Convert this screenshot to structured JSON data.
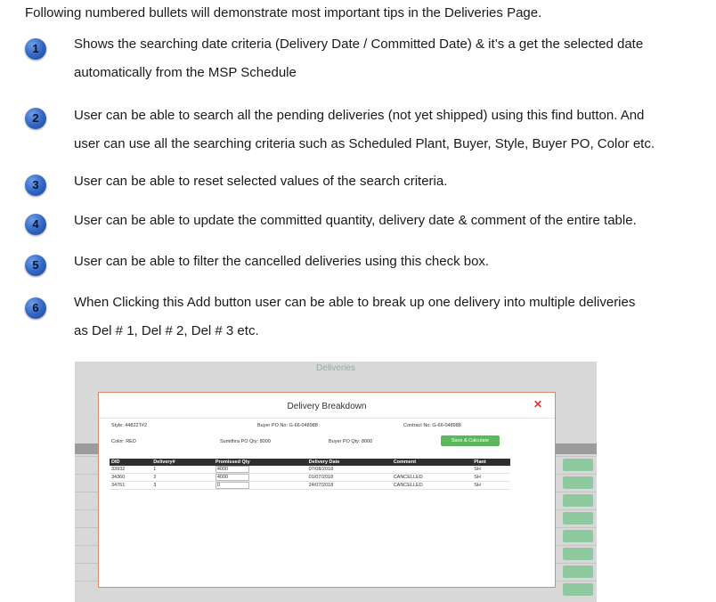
{
  "intro": "Following numbered bullets will demonstrate most important tips in the Deliveries Page.",
  "bullets": [
    {
      "number": "1",
      "line1": "Shows the searching date criteria (Delivery Date / Committed Date) & it’s a get the selected date",
      "line2": "automatically from the MSP Schedule"
    },
    {
      "number": "2",
      "line1": "User can be able to search all the pending deliveries (not yet shipped) using this find button. And",
      "line2": "user can use all the searching criteria such as Scheduled Plant, Buyer, Style, Buyer PO, Color etc."
    },
    {
      "number": "3",
      "line1": "User can be able to reset selected values of the search criteria."
    },
    {
      "number": "4",
      "line1": "User can be able to update the committed quantity, delivery date & comment of the entire table."
    },
    {
      "number": "5",
      "line1": "User can be able to filter the cancelled deliveries using this check box."
    },
    {
      "number": "6",
      "line1": "When Clicking this Add button user can be able to break up one delivery into multiple deliveries",
      "line2": "as Del # 1, Del # 2, Del # 3 etc."
    }
  ],
  "screenshot": {
    "background_title": "Deliveries",
    "modal": {
      "title": "Delivery Breakdown",
      "close_glyph": "✕",
      "style": "Style: 44822T#2",
      "buyer_po_no": "Buyer PO No: G-66-048988",
      "contract_no": "Contract No: G-66-048988",
      "color": "Color: RED",
      "sumithra_po_qty": "Sumithra PO Qty: 8000",
      "buyer_po_qty": "Buyer PO Qty: 8000",
      "save_button": "Save & Calculate",
      "columns": [
        "DID",
        "Delivery#",
        "Promissed Qty",
        "Delivery Date",
        "Comment",
        "Plant"
      ],
      "rows": [
        [
          "33932",
          "1",
          "4000",
          "07/08/2018",
          "",
          "SH"
        ],
        [
          "34360",
          "2",
          "4000",
          "01/07/2018",
          "CANCELLED",
          "SH"
        ],
        [
          "34761",
          "3",
          "0",
          "24/07/2018",
          "CANCELLED",
          "SH"
        ]
      ]
    },
    "background_update_label": "Update"
  },
  "colors": {
    "accent": "#2f64c2",
    "save": "#5cb85c",
    "close": "#dd3333"
  }
}
